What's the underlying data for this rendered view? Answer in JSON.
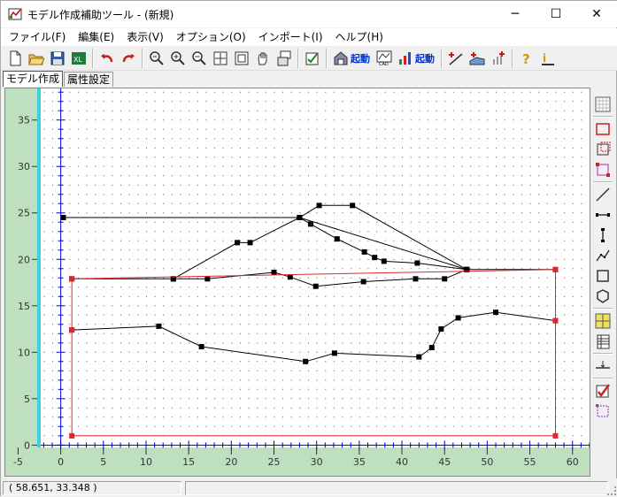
{
  "window": {
    "title": "モデル作成補助ツール - (新規)",
    "min_glyph": "─",
    "max_glyph": "☐",
    "close_glyph": "✕"
  },
  "menu": [
    "ファイル(F)",
    "編集(E)",
    "表示(V)",
    "オプション(O)",
    "インポート(I)",
    "ヘルプ(H)"
  ],
  "toolbar": {
    "launch1": "起動",
    "launch2": "起動",
    "launch1_icon": "house-calc-icon",
    "launch2_icon": "bar-chart-icon"
  },
  "tabs": [
    "モデル作成",
    "属性設定"
  ],
  "status": {
    "coords": "(   58.651,   33.348 )"
  },
  "colors": {
    "ruler": "#bfe0c0",
    "accent_cyan": "#3cd2dc",
    "axis": "#0000cc",
    "boundary": "#e0262e",
    "line": "#000000"
  },
  "chart_data": {
    "type": "line",
    "x_ticks": [
      -5,
      0,
      5,
      10,
      15,
      20,
      25,
      30,
      35,
      40,
      45,
      50,
      55,
      60
    ],
    "y_ticks": [
      0,
      5,
      10,
      15,
      20,
      25,
      30,
      35
    ],
    "xlim": [
      -6.5,
      62
    ],
    "ylim": [
      -3.3,
      38.4
    ],
    "grid": true,
    "boundary": {
      "name": "",
      "points": [
        [
          1.3,
          1.0
        ],
        [
          1.3,
          12.4
        ],
        [
          1.3,
          17.9
        ],
        [
          58.0,
          18.9
        ],
        [
          58.0,
          13.4
        ],
        [
          58.0,
          1.0
        ],
        [
          1.3,
          1.0
        ]
      ]
    },
    "polylines": [
      {
        "points": [
          [
            0.3,
            24.5
          ],
          [
            28.0,
            24.5
          ],
          [
            47.6,
            18.9
          ]
        ]
      },
      {
        "points": [
          [
            13.2,
            17.9
          ],
          [
            20.7,
            21.8
          ],
          [
            22.2,
            21.8
          ],
          [
            28.0,
            24.5
          ],
          [
            29.3,
            23.8
          ],
          [
            32.4,
            22.2
          ],
          [
            35.6,
            20.8
          ],
          [
            36.8,
            20.2
          ],
          [
            37.9,
            19.8
          ],
          [
            41.8,
            19.6
          ],
          [
            47.6,
            18.9
          ]
        ]
      },
      {
        "points": [
          [
            28.0,
            24.5
          ],
          [
            30.3,
            25.8
          ],
          [
            34.2,
            25.8
          ],
          [
            47.6,
            18.9
          ]
        ]
      },
      {
        "points": [
          [
            1.3,
            17.9
          ],
          [
            13.2,
            17.9
          ],
          [
            17.2,
            17.9
          ],
          [
            25.0,
            18.6
          ],
          [
            26.9,
            18.1
          ],
          [
            29.9,
            17.1
          ],
          [
            35.5,
            17.6
          ],
          [
            41.6,
            17.9
          ],
          [
            45.0,
            17.9
          ],
          [
            47.6,
            18.9
          ],
          [
            58.0,
            18.9
          ]
        ]
      },
      {
        "points": [
          [
            1.3,
            12.4
          ],
          [
            11.5,
            12.8
          ],
          [
            16.5,
            10.6
          ],
          [
            28.7,
            9.0
          ],
          [
            32.1,
            9.9
          ],
          [
            42.0,
            9.5
          ],
          [
            43.5,
            10.5
          ],
          [
            44.6,
            12.5
          ],
          [
            46.6,
            13.7
          ],
          [
            51.0,
            14.3
          ],
          [
            58.0,
            13.4
          ]
        ]
      }
    ]
  }
}
